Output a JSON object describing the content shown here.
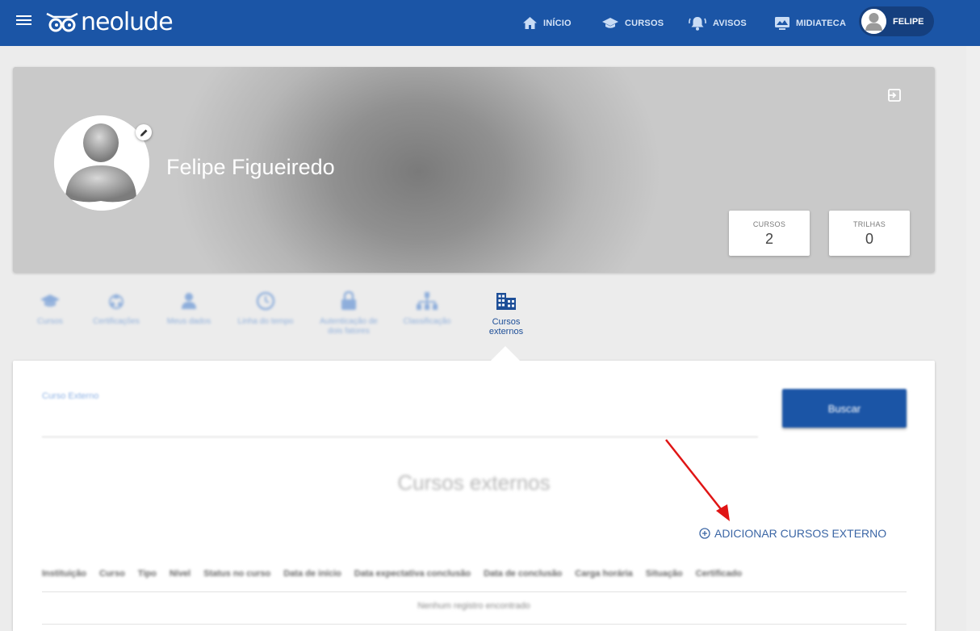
{
  "header": {
    "logo_text": "neolude",
    "nav": [
      {
        "label": "INÍCIO",
        "icon": "home-icon"
      },
      {
        "label": "CURSOS",
        "icon": "graduation-cap-icon"
      },
      {
        "label": "AVISOS",
        "icon": "bell-icon"
      },
      {
        "label": "MIDIATECA",
        "icon": "media-library-icon"
      }
    ],
    "user_name": "FELIPE",
    "accent_color": "#1b55a6"
  },
  "profile": {
    "name": "Felipe Figueiredo",
    "stats": [
      {
        "label": "CURSOS",
        "value": "2"
      },
      {
        "label": "TRILHAS",
        "value": "0"
      }
    ]
  },
  "tabs": [
    {
      "label": "Cursos",
      "icon": "graduation-cap-icon",
      "active": false
    },
    {
      "label": "Certificações",
      "icon": "recycle-icon",
      "active": false
    },
    {
      "label": "Meus dados",
      "icon": "person-icon",
      "active": false
    },
    {
      "label": "Linha do tempo",
      "icon": "clock-icon",
      "active": false
    },
    {
      "label": "Autenticação de dois fatores",
      "icon": "lock-icon",
      "active": false
    },
    {
      "label": "Classificação",
      "icon": "hierarchy-icon",
      "active": false
    },
    {
      "label": "Cursos externos",
      "icon": "building-icon",
      "active": true
    }
  ],
  "content": {
    "search_label": "Curso Externo",
    "search_button": "Buscar",
    "section_title": "Cursos externos",
    "add_link": "ADICIONAR CURSOS EXTERNO",
    "table_columns": [
      "Instituição",
      "Curso",
      "Tipo",
      "Nível",
      "Status no curso",
      "Data de início",
      "Data expectativa conclusão",
      "Data de conclusão",
      "Carga horária",
      "Situação",
      "Certificado"
    ],
    "empty_message": "Nenhum registro encontrado"
  }
}
